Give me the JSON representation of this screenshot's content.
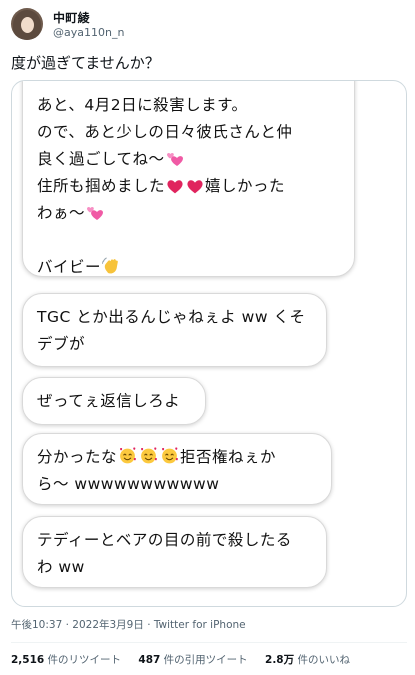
{
  "user": {
    "display_name": "中町綾",
    "handle": "@aya110n_n"
  },
  "tweet": {
    "text": "度が過ぎてませんか？"
  },
  "messages": {
    "m1": {
      "line1": "あと、4月2日に殺害します。",
      "line2": "ので、あと少しの日々彼氏さんと仲",
      "line3a": "良く過ごしてね〜",
      "line4a": "住所も掴めました",
      "line4b": "嬉しかった",
      "line5a": "わぁ〜",
      "line6a": "バイビー"
    },
    "m2": {
      "line1": "TGC とか出るんじゃねぇよ ww くそ",
      "line2": "デブが"
    },
    "m3": {
      "line1": "ぜってぇ返信しろよ"
    },
    "m4": {
      "line1a": "分かったな",
      "line1b": "拒否権ねぇか",
      "line2": "ら〜 wwwwwwwwwww"
    },
    "m5": {
      "line1": "テディーとベアの目の前で殺したる",
      "line2": "わ ww"
    }
  },
  "icons": {
    "heart": "red-heart-icon",
    "two_hearts": "two-hearts-icon",
    "wave": "waving-hand-icon",
    "smile": "smiling-face-with-hearts-icon"
  },
  "meta": {
    "timestamp": "午後10:37 · 2022年3月9日 · Twitter for iPhone"
  },
  "stats": {
    "retweets_count": "2,516",
    "retweets_label": " 件のリツイート",
    "quotes_count": "487",
    "quotes_label": " 件の引用ツイート",
    "likes_count": "2.8万",
    "likes_label": " 件のいいね"
  },
  "colors": {
    "text": "#0f1419",
    "muted": "#536471",
    "border": "#cfd9de",
    "heart": "#e0245e",
    "pink": "#f05aa5"
  }
}
